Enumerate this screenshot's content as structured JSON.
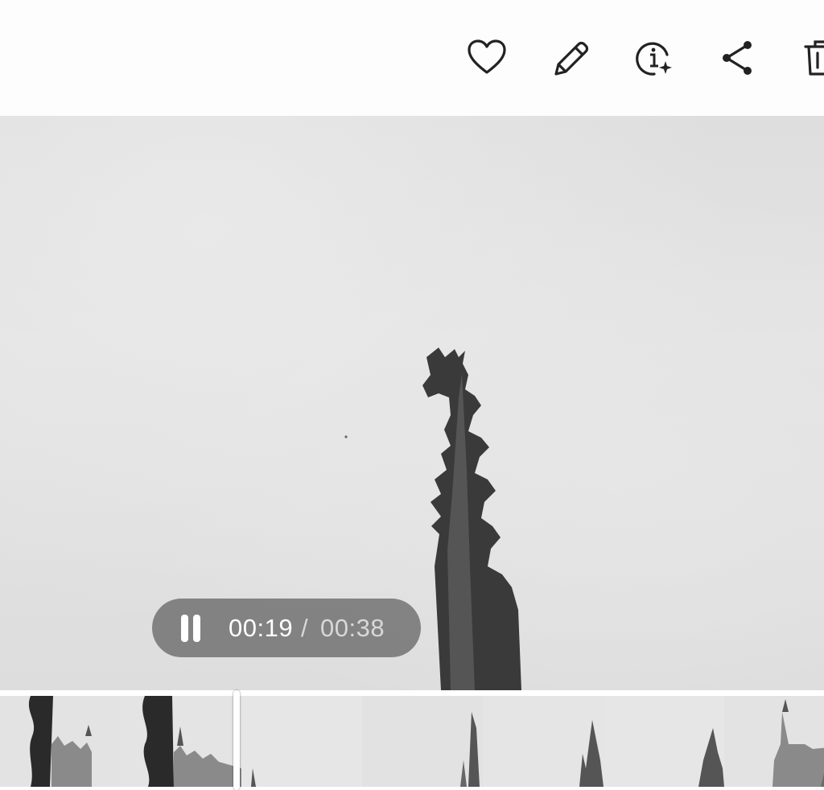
{
  "toolbar": {
    "icons": [
      "heart-icon",
      "pencil-icon",
      "info-sparkle-icon",
      "share-icon",
      "trash-icon"
    ]
  },
  "player": {
    "current_time": "00:19",
    "separator": "/",
    "total_time": "00:38",
    "state": "playing",
    "progress": 0.5
  },
  "filmstrip": {
    "frame_count": 7
  },
  "colors": {
    "pill_bg": "#6e6e6e",
    "sky": "#e2e2e2",
    "icon_stroke": "#222222"
  }
}
